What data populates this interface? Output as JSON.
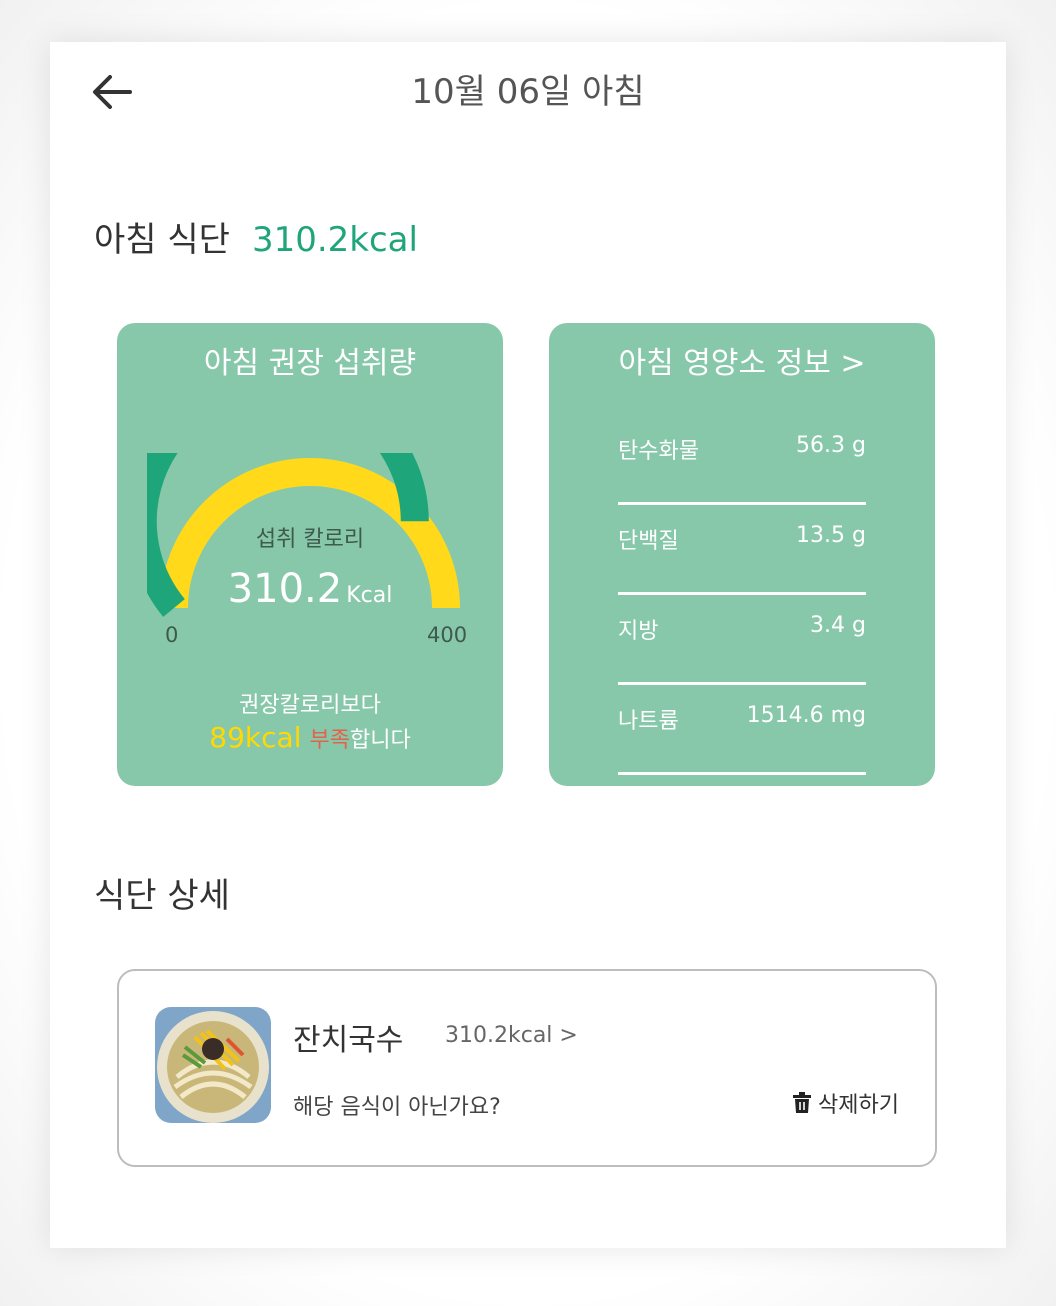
{
  "header": {
    "title": "10월 06일 아침"
  },
  "summary": {
    "label": "아침 식단",
    "kcal": "310.2kcal"
  },
  "recommended_card": {
    "title": "아침 권장 섭취량",
    "gauge_label": "섭취 칼로리",
    "gauge_value": "310.2",
    "gauge_unit": "Kcal",
    "gauge_min": "0",
    "gauge_max": "400",
    "gauge_fill_fraction": 0.78,
    "compare_line1": "권장칼로리보다",
    "compare_amount": "89kcal",
    "compare_short": "부족",
    "compare_suffix": "합니다",
    "colors": {
      "intake": "#1fa57a",
      "remaining": "#ffd91a",
      "card": "#88c8aa"
    }
  },
  "nutrition_card": {
    "title": "아침 영양소 정보 >",
    "items": [
      {
        "name": "탄수화물",
        "value": "56.3 g"
      },
      {
        "name": "단백질",
        "value": "13.5 g"
      },
      {
        "name": "지방",
        "value": "3.4 g"
      },
      {
        "name": "나트륨",
        "value": "1514.6 mg"
      }
    ]
  },
  "detail": {
    "title": "식단 상세",
    "food": {
      "name": "잔치국수",
      "kcal": "310.2kcal  >",
      "question": "해당 음식이 아닌가요?",
      "delete_label": "삭제하기"
    }
  }
}
